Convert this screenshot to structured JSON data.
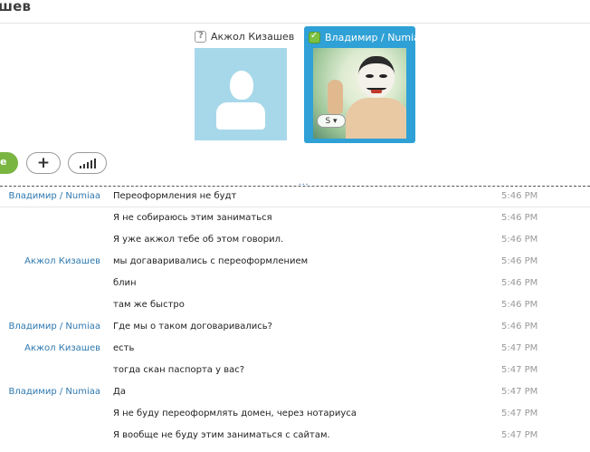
{
  "header": {
    "title": "шев"
  },
  "participants": [
    {
      "name": "Акжол Кизашев",
      "status": "unknown",
      "avatar": "default-silhouette"
    },
    {
      "name": "Владимир / Numiaa",
      "status": "online",
      "avatar": "photo",
      "selected": true,
      "call_button_label": "S ▾"
    }
  ],
  "controls": {
    "green_label": "е",
    "add_label": "+",
    "signal_icon": "signal-bars-icon"
  },
  "divider": {
    "dots": "..."
  },
  "messages": [
    {
      "sender": "Владимир / Numiaa",
      "text": "Переоформления не будт",
      "time": "5:46 PM"
    },
    {
      "sender": "",
      "text": "Я не собираюсь этим заниматься",
      "time": "5:46 PM"
    },
    {
      "sender": "",
      "text": "Я уже акжол тебе об этом говорил.",
      "time": "5:46 PM"
    },
    {
      "sender": "Акжол Кизашев",
      "text": "мы догаваривались с переоформлением",
      "time": "5:46 PM"
    },
    {
      "sender": "",
      "text": "блин",
      "time": "5:46 PM"
    },
    {
      "sender": "",
      "text": "там же быстро",
      "time": "5:46 PM"
    },
    {
      "sender": "Владимир / Numiaa",
      "text": "Где мы о таком договаривались?",
      "time": "5:46 PM"
    },
    {
      "sender": "Акжол Кизашев",
      "text": "есть",
      "time": "5:47 PM"
    },
    {
      "sender": "",
      "text": "тогда скан паспорта у вас?",
      "time": "5:47 PM"
    },
    {
      "sender": "Владимир / Numiaa",
      "text": "Да",
      "time": "5:47 PM"
    },
    {
      "sender": "",
      "text": "Я не буду переоформлять домен, через нотариуса",
      "time": "5:47 PM"
    },
    {
      "sender": "",
      "text": "Я вообще не буду этим заниматься с сайтам.",
      "time": "5:47 PM"
    }
  ],
  "colors": {
    "accent_blue": "#2fa1d6",
    "sender_blue": "#2f79b0",
    "online_green": "#7dc142",
    "avatar_placeholder": "#a7d8ea"
  }
}
